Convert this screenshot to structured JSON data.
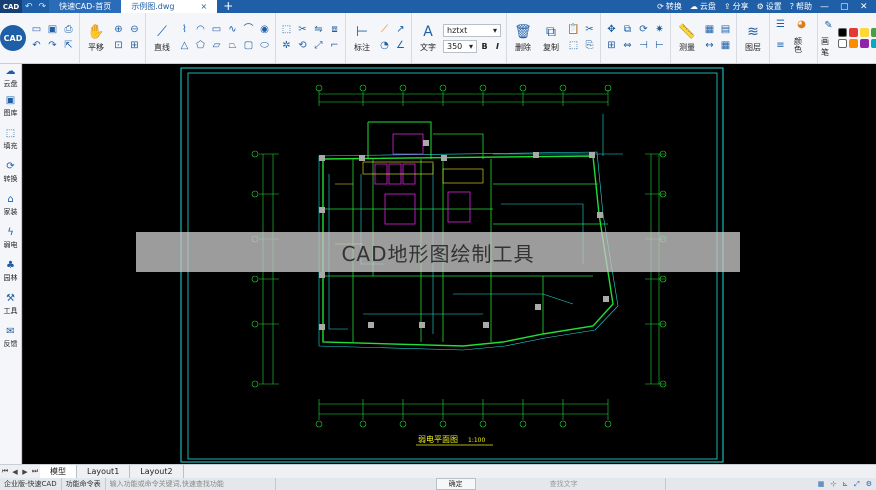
{
  "titlebar": {
    "logo": "CAD",
    "home_tab": "快速CAD-首页",
    "doc_tab": "示例图.dwg",
    "doc_close": "×",
    "new_tab": "+",
    "convert": "转换",
    "cloud": "云盘",
    "share": "分享",
    "settings": "设置",
    "help": "帮助"
  },
  "ribbon": {
    "pan_label": "平移",
    "line_label": "直线",
    "annotate_label": "标注",
    "text_label": "文字",
    "font_value": "hztxt",
    "size_value": "350",
    "bold": "B",
    "italic": "I",
    "delete_label": "删除",
    "copy_label": "复制",
    "measure_label": "测量",
    "layer_label": "图层",
    "color_label": "颜色",
    "pen_label": "画笔"
  },
  "sidebar": {
    "items": [
      {
        "icon": "cloud-icon",
        "label": "云盘"
      },
      {
        "icon": "library-icon",
        "label": "图库"
      },
      {
        "icon": "fill-icon",
        "label": "填充"
      },
      {
        "icon": "convert-icon",
        "label": "转换"
      },
      {
        "icon": "home-icon",
        "label": "家装"
      },
      {
        "icon": "power-icon",
        "label": "弱电"
      },
      {
        "icon": "tree-icon",
        "label": "园林"
      },
      {
        "icon": "tool-icon",
        "label": "工具"
      },
      {
        "icon": "mail-icon",
        "label": "反馈"
      }
    ]
  },
  "drawing": {
    "plan_title": "弱电平面图",
    "scale": "1:100",
    "banner_text": "CAD地形图绘制工具"
  },
  "layout_tabs": [
    "模型",
    "Layout1",
    "Layout2"
  ],
  "statusbar": {
    "edition": "企业版-快速CAD",
    "command_label": "功能命令表",
    "command_placeholder": "输入功能或命令关键词,快速查找功能",
    "ok": "确定",
    "search_placeholder": "查找文字"
  },
  "colors": {
    "brand_blue": "#1f5fa8",
    "canvas_bg": "#000000",
    "cad_green": "#22dd33",
    "cad_cyan": "#22dddd",
    "cad_yellow": "#eeee22",
    "cad_magenta": "#dd22dd"
  }
}
